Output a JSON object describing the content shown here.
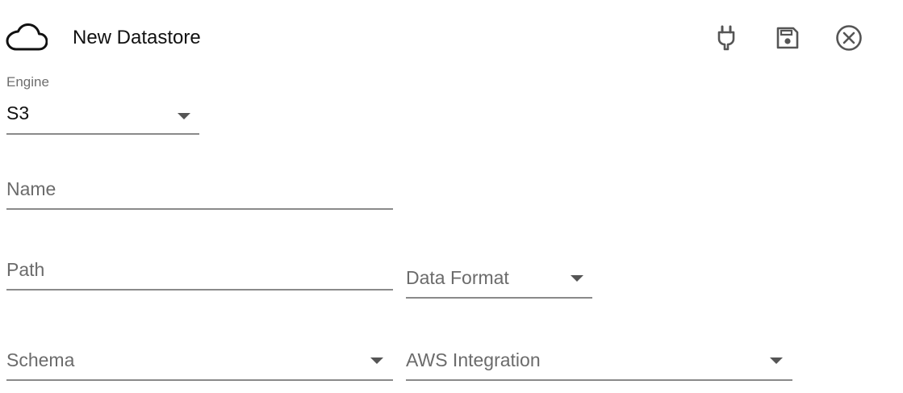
{
  "header": {
    "title": "New Datastore",
    "icons": [
      "cloud-icon",
      "plug-icon",
      "save-icon",
      "close-circle-icon"
    ]
  },
  "engine": {
    "label": "Engine",
    "value": "S3"
  },
  "name_field": {
    "placeholder": "Name"
  },
  "path_field": {
    "placeholder": "Path"
  },
  "data_format": {
    "placeholder": "Data Format"
  },
  "schema": {
    "placeholder": "Schema"
  },
  "aws_integration": {
    "placeholder": "AWS Integration"
  },
  "colors": {
    "text": "#111111",
    "muted": "#6b6b6b",
    "underline": "#8a8a8a"
  }
}
